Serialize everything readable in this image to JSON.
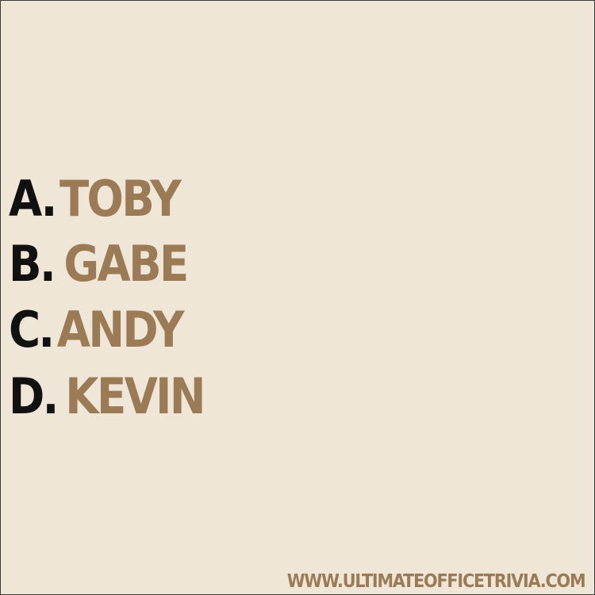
{
  "options": [
    {
      "letter": "A.",
      "answer": "TOBY"
    },
    {
      "letter": "B.",
      "answer": "GABE"
    },
    {
      "letter": "C.",
      "answer": "ANDY"
    },
    {
      "letter": "D.",
      "answer": "KEVIN"
    }
  ],
  "footer": {
    "url": "WWW.ULTIMATEOFFICETRIVIA.COM"
  },
  "colors": {
    "background": "#f0e6d8",
    "letter": "#111111",
    "answer": "#9a7b56"
  }
}
